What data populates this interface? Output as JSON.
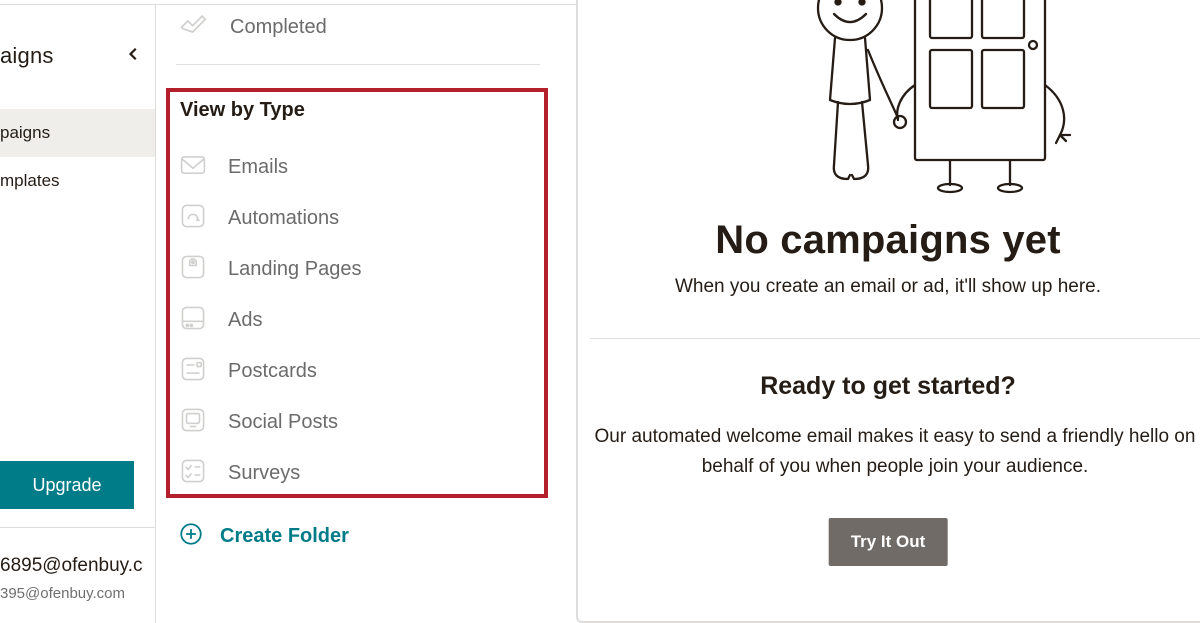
{
  "sidebar": {
    "title": "aigns",
    "items": [
      {
        "label": "paigns"
      },
      {
        "label": "mplates"
      }
    ],
    "upgrade_label": "Upgrade",
    "email_primary": "6895@ofenbuy.c",
    "email_secondary": "395@ofenbuy.com"
  },
  "status": {
    "completed_label": "Completed"
  },
  "types": {
    "header": "View by Type",
    "items": [
      {
        "label": "Emails"
      },
      {
        "label": "Automations"
      },
      {
        "label": "Landing Pages"
      },
      {
        "label": "Ads"
      },
      {
        "label": "Postcards"
      },
      {
        "label": "Social Posts"
      },
      {
        "label": "Surveys"
      }
    ]
  },
  "create_folder_label": "Create Folder",
  "main": {
    "empty_title": "No campaigns yet",
    "empty_sub": "When you create an email or ad, it'll show up here.",
    "ready_title": "Ready to get started?",
    "ready_body": "Our automated welcome email makes it easy to send a friendly hello on behalf of you when people join your audience.",
    "try_label": "Try It Out"
  },
  "colors": {
    "accent": "#007c89",
    "highlight_border": "#b3202c"
  }
}
